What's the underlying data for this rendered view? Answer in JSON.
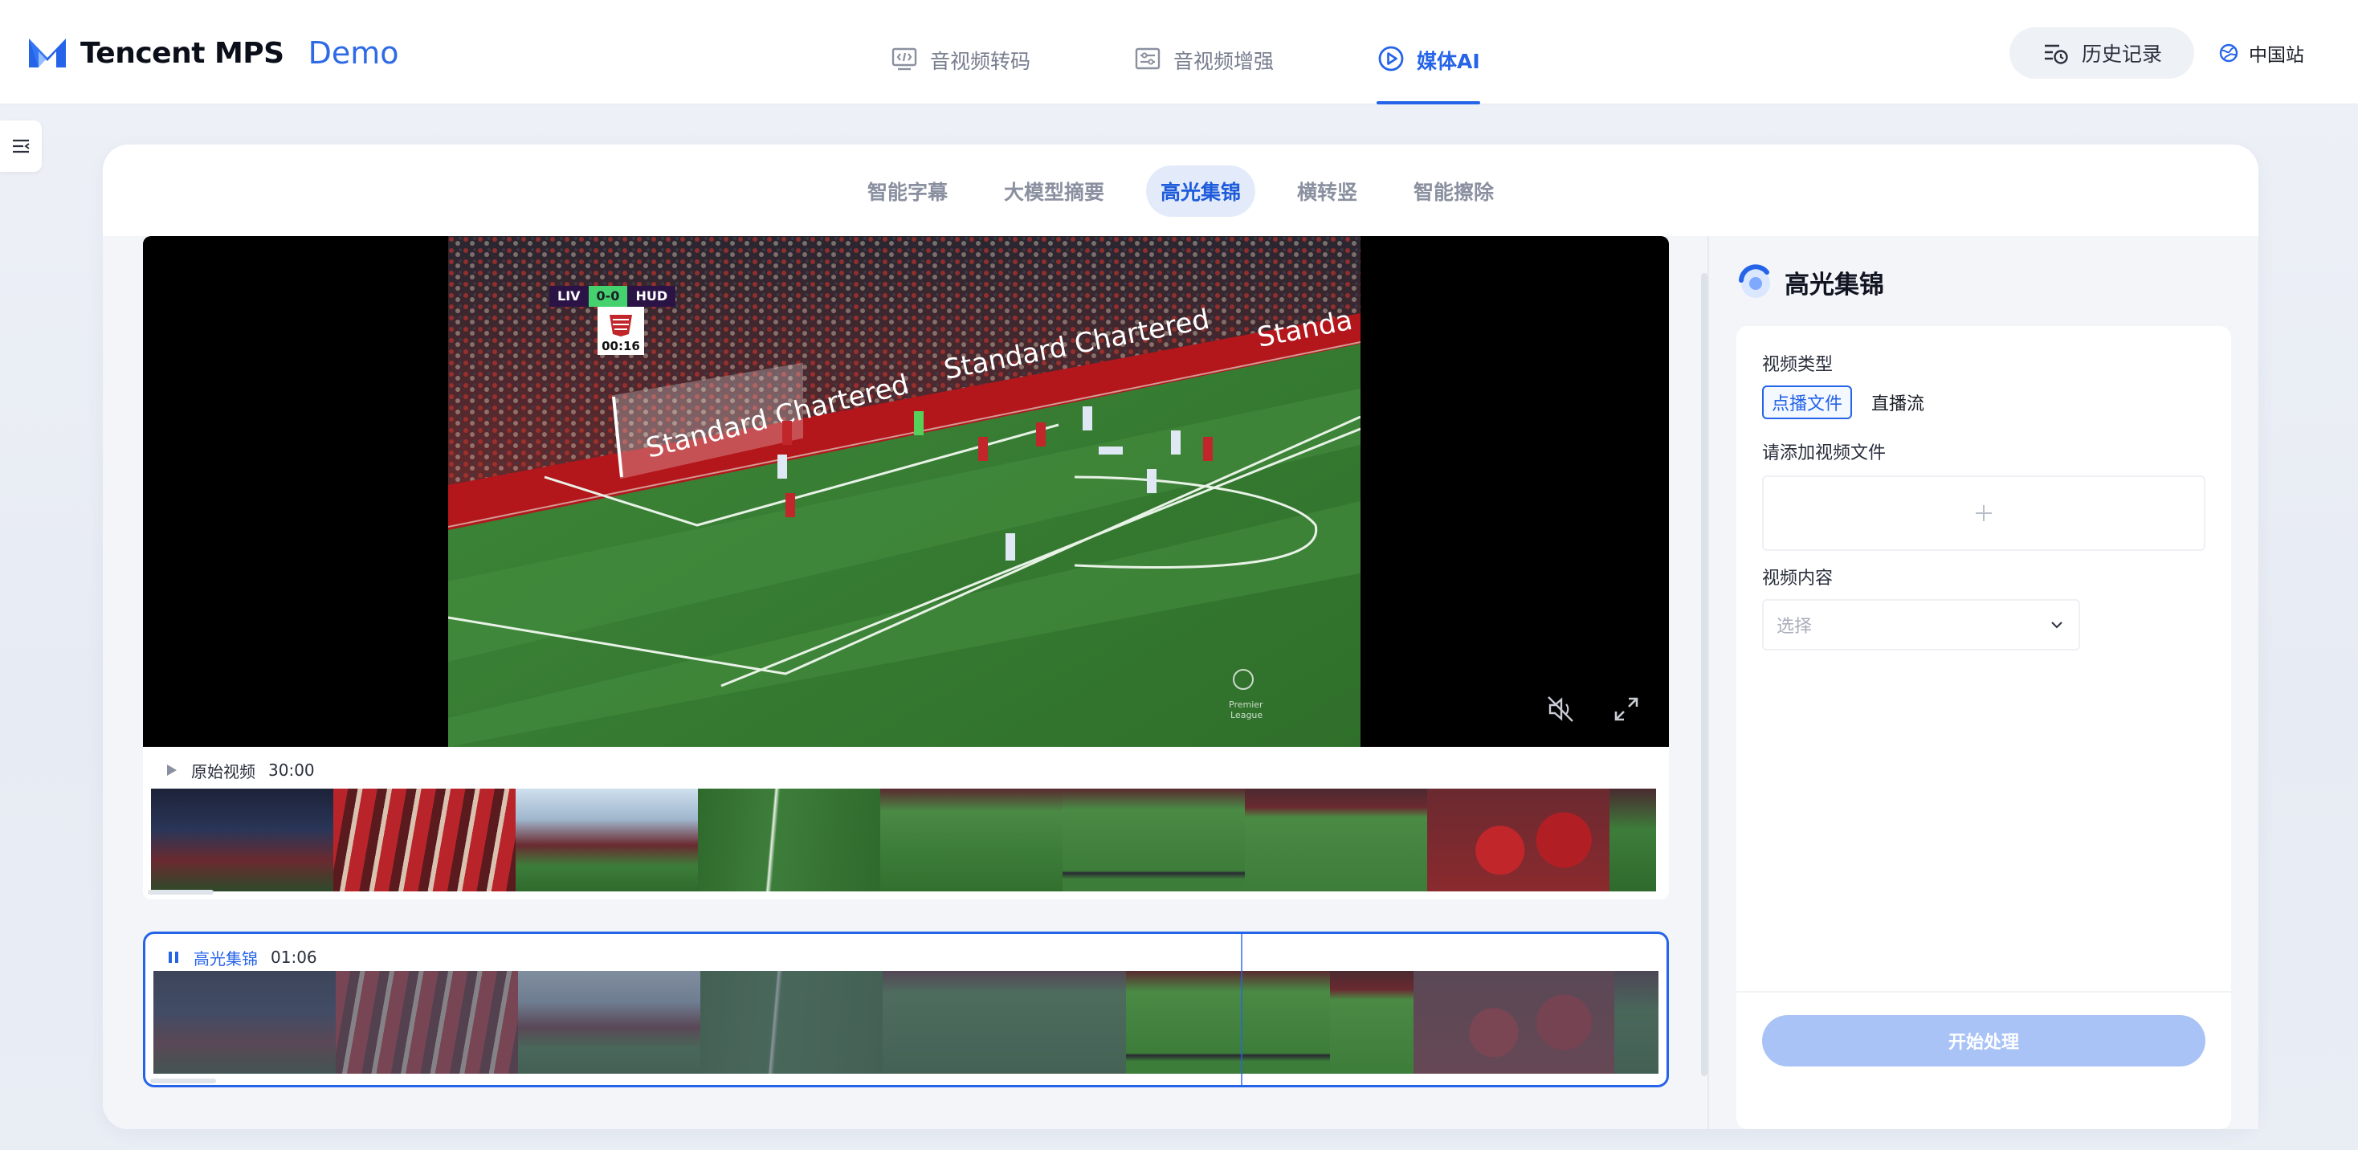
{
  "brand": {
    "name": "Tencent MPS",
    "demo_label": "Demo",
    "color": "#2563e9"
  },
  "main_nav": [
    {
      "label": "音视频转码",
      "icon": "transcode-icon",
      "active": false
    },
    {
      "label": "音视频增强",
      "icon": "enhance-icon",
      "active": false
    },
    {
      "label": "媒体AI",
      "icon": "play-circle-icon",
      "active": true
    }
  ],
  "header": {
    "history_label": "历史记录",
    "region_label": "中国站"
  },
  "sub_tabs": [
    {
      "label": "智能字幕",
      "active": false
    },
    {
      "label": "大模型摘要",
      "active": false
    },
    {
      "label": "高光集锦",
      "active": true
    },
    {
      "label": "横转竖",
      "active": false
    },
    {
      "label": "智能擦除",
      "active": false
    }
  ],
  "player": {
    "scoreboard": {
      "home": "LIV",
      "score": "0-0",
      "away": "HUD",
      "clock": "00:16"
    },
    "controls": [
      "mute-icon",
      "fullscreen-exit-icon"
    ]
  },
  "tracks": {
    "original": {
      "name": "原始视频",
      "duration": "30:00",
      "state": "paused"
    },
    "highlight": {
      "name": "高光集锦",
      "duration": "01:06",
      "state": "playing"
    }
  },
  "panel": {
    "title": "高光集锦",
    "video_type_label": "视频类型",
    "video_type_options": [
      {
        "label": "点播文件",
        "selected": true
      },
      {
        "label": "直播流",
        "selected": false
      }
    ],
    "add_file_label": "请添加视频文件",
    "content_label": "视频内容",
    "content_placeholder": "选择",
    "start_label": "开始处理"
  }
}
